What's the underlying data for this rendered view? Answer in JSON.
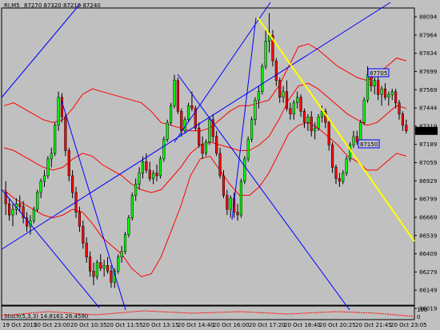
{
  "header": {
    "symbol": "RI,M5",
    "ohlc": "87270 87320 87210 87240"
  },
  "price_axis": {
    "ticks": [
      "88094",
      "87964",
      "87834",
      "87699",
      "87569",
      "87444",
      "87319",
      "87189",
      "87059",
      "86929",
      "86799",
      "86669",
      "86539",
      "86409",
      "86279",
      "86149",
      "86019"
    ],
    "current_price": "87240",
    "marker_high": "87705",
    "marker_low": "87150"
  },
  "time_axis": {
    "ticks": [
      "19 Oct 2015",
      "20 Oct 23:00",
      "20 Oct 10:35",
      "20 Oct 11:55",
      "20 Oct 13:15",
      "20 Oct 14:40",
      "20 Oct 16:00",
      "20 Oct 17:20",
      "20 Oct 18:40",
      "20 Oct 20:25",
      "20 Oct 21:45",
      "20 Oct 23:05"
    ]
  },
  "indicator": {
    "label": "Stoch(5,3,3) 14.8161 26.4590",
    "scale_top": "100",
    "scale_bottom": "0"
  },
  "colors": {
    "background": "#c0c0c0",
    "bull": "#00ff00",
    "bear": "#ff0000",
    "wick": "#000000",
    "bands": "#ff0000",
    "trendlines": "#0000ff",
    "fibo_line": "#ffff00"
  },
  "chart_data": {
    "type": "candlestick",
    "symbol": "RI,M5",
    "ylim": [
      86019,
      88094
    ],
    "candles": [
      [
        86800,
        86880,
        86640,
        86720
      ],
      [
        86720,
        86760,
        86600,
        86640
      ],
      [
        86640,
        86720,
        86560,
        86680
      ],
      [
        86680,
        86760,
        86640,
        86720
      ],
      [
        86720,
        86780,
        86660,
        86700
      ],
      [
        86700,
        86740,
        86580,
        86620
      ],
      [
        86620,
        86660,
        86520,
        86560
      ],
      [
        86560,
        86640,
        86500,
        86600
      ],
      [
        86600,
        86700,
        86580,
        86680
      ],
      [
        86680,
        86820,
        86660,
        86800
      ],
      [
        86800,
        86900,
        86760,
        86880
      ],
      [
        86880,
        86960,
        86840,
        86920
      ],
      [
        86920,
        87060,
        86900,
        87040
      ],
      [
        87040,
        87120,
        86980,
        87080
      ],
      [
        87080,
        87300,
        87060,
        87280
      ],
      [
        87280,
        87520,
        87240,
        87480
      ],
      [
        87480,
        87510,
        87300,
        87340
      ],
      [
        87340,
        87360,
        87060,
        87100
      ],
      [
        87100,
        87120,
        86880,
        86920
      ],
      [
        86920,
        86960,
        86760,
        86800
      ],
      [
        86800,
        86840,
        86620,
        86660
      ],
      [
        86660,
        86700,
        86520,
        86560
      ],
      [
        86560,
        86600,
        86400,
        86440
      ],
      [
        86440,
        86480,
        86300,
        86340
      ],
      [
        86340,
        86380,
        86200,
        86240
      ],
      [
        86240,
        86300,
        86140,
        86200
      ],
      [
        86200,
        86320,
        86180,
        86300
      ],
      [
        86300,
        86360,
        86240,
        86260
      ],
      [
        86260,
        86320,
        86200,
        86280
      ],
      [
        86280,
        86340,
        86220,
        86240
      ],
      [
        86240,
        86280,
        86120,
        86160
      ],
      [
        86160,
        86260,
        86120,
        86240
      ],
      [
        86240,
        86360,
        86220,
        86340
      ],
      [
        86340,
        86420,
        86300,
        86380
      ],
      [
        86380,
        86520,
        86360,
        86500
      ],
      [
        86500,
        86640,
        86480,
        86620
      ],
      [
        86620,
        86800,
        86600,
        86780
      ],
      [
        86780,
        86900,
        86740,
        86860
      ],
      [
        86860,
        86980,
        86820,
        86940
      ],
      [
        86940,
        87060,
        86900,
        87020
      ],
      [
        87020,
        87080,
        86940,
        86960
      ],
      [
        86960,
        87020,
        86880,
        86900
      ],
      [
        86900,
        86960,
        86860,
        86940
      ],
      [
        86940,
        87000,
        86880,
        86920
      ],
      [
        86920,
        87060,
        86900,
        87040
      ],
      [
        87040,
        87200,
        87020,
        87180
      ],
      [
        87180,
        87320,
        87160,
        87300
      ],
      [
        87300,
        87440,
        87280,
        87420
      ],
      [
        87420,
        87640,
        87400,
        87600
      ],
      [
        87600,
        87620,
        87360,
        87380
      ],
      [
        87380,
        87400,
        87200,
        87240
      ],
      [
        87240,
        87340,
        87220,
        87320
      ],
      [
        87320,
        87440,
        87300,
        87420
      ],
      [
        87420,
        87520,
        87380,
        87400
      ],
      [
        87400,
        87420,
        87240,
        87260
      ],
      [
        87260,
        87300,
        87120,
        87140
      ],
      [
        87140,
        87200,
        87040,
        87080
      ],
      [
        87080,
        87180,
        87060,
        87160
      ],
      [
        87160,
        87340,
        87140,
        87320
      ],
      [
        87320,
        87360,
        87160,
        87200
      ],
      [
        87200,
        87240,
        87060,
        87080
      ],
      [
        87080,
        87120,
        86900,
        86920
      ],
      [
        86920,
        86960,
        86760,
        86780
      ],
      [
        86780,
        86820,
        86640,
        86680
      ],
      [
        86680,
        86780,
        86620,
        86760
      ],
      [
        86760,
        86800,
        86620,
        86660
      ],
      [
        86660,
        86720,
        86600,
        86640
      ],
      [
        86640,
        86900,
        86620,
        86880
      ],
      [
        86880,
        87060,
        86860,
        87040
      ],
      [
        87040,
        87200,
        87020,
        87180
      ],
      [
        87180,
        87340,
        87160,
        87320
      ],
      [
        87320,
        87480,
        87280,
        87460
      ],
      [
        87460,
        87560,
        87400,
        87520
      ],
      [
        87520,
        87720,
        87500,
        87700
      ],
      [
        87700,
        87960,
        87680,
        87880
      ],
      [
        87880,
        88080,
        87800,
        87920
      ],
      [
        87920,
        87960,
        87700,
        87740
      ],
      [
        87740,
        87760,
        87560,
        87600
      ],
      [
        87600,
        87620,
        87440,
        87480
      ],
      [
        87480,
        87560,
        87440,
        87520
      ],
      [
        87520,
        87600,
        87380,
        87400
      ],
      [
        87400,
        87440,
        87320,
        87360
      ],
      [
        87360,
        87460,
        87320,
        87440
      ],
      [
        87440,
        87520,
        87400,
        87480
      ],
      [
        87480,
        87500,
        87340,
        87380
      ],
      [
        87380,
        87400,
        87260,
        87300
      ],
      [
        87300,
        87360,
        87240,
        87340
      ],
      [
        87340,
        87380,
        87200,
        87240
      ],
      [
        87240,
        87300,
        87180,
        87260
      ],
      [
        87260,
        87360,
        87240,
        87340
      ],
      [
        87340,
        87420,
        87300,
        87380
      ],
      [
        87380,
        87400,
        87260,
        87300
      ],
      [
        87300,
        87320,
        87100,
        87140
      ],
      [
        87140,
        87160,
        86940,
        86980
      ],
      [
        86980,
        87000,
        86860,
        86900
      ],
      [
        86900,
        86940,
        86840,
        86880
      ],
      [
        86880,
        86960,
        86860,
        86940
      ],
      [
        86940,
        87060,
        86920,
        87040
      ],
      [
        87040,
        87160,
        87020,
        87140
      ],
      [
        87140,
        87240,
        87120,
        87200
      ],
      [
        87200,
        87240,
        87140,
        87160
      ],
      [
        87160,
        87320,
        87140,
        87300
      ],
      [
        87300,
        87480,
        87280,
        87460
      ],
      [
        87460,
        87700,
        87440,
        87640
      ],
      [
        87640,
        87680,
        87520,
        87560
      ],
      [
        87560,
        87620,
        87500,
        87600
      ],
      [
        87600,
        87640,
        87460,
        87500
      ],
      [
        87500,
        87560,
        87420,
        87540
      ],
      [
        87540,
        87580,
        87460,
        87480
      ],
      [
        87480,
        87520,
        87420,
        87500
      ],
      [
        87500,
        87540,
        87460,
        87520
      ],
      [
        87520,
        87540,
        87400,
        87440
      ],
      [
        87440,
        87460,
        87320,
        87360
      ],
      [
        87360,
        87380,
        87240,
        87280
      ],
      [
        87280,
        87320,
        87220,
        87240
      ]
    ],
    "bands": {
      "upper": [
        87420,
        87440,
        87400,
        87360,
        87320,
        87300,
        87320,
        87400,
        87500,
        87540,
        87520,
        87500,
        87480,
        87460,
        87440,
        87380,
        87300,
        87280,
        87260,
        87240,
        87240,
        87260,
        87320,
        87380,
        87420,
        87420,
        87440,
        87460,
        87560,
        87700,
        87840,
        87860,
        87820,
        87760,
        87700,
        87660,
        87620,
        87600,
        87640,
        87700,
        87760,
        87740
      ],
      "middle": [
        87120,
        87100,
        87060,
        87020,
        86980,
        86960,
        86980,
        87040,
        87080,
        87060,
        87000,
        86960,
        86920,
        86860,
        86820,
        86800,
        86820,
        86900,
        86980,
        87080,
        87140,
        87160,
        87140,
        87120,
        87100,
        87100,
        87140,
        87200,
        87320,
        87460,
        87560,
        87580,
        87540,
        87480,
        87420,
        87360,
        87320,
        87280,
        87300,
        87360,
        87420,
        87400
      ],
      "lower": [
        86820,
        86760,
        86720,
        86680,
        86640,
        86620,
        86640,
        86680,
        86660,
        86580,
        86480,
        86420,
        86360,
        86260,
        86200,
        86220,
        86340,
        86520,
        86700,
        86920,
        87040,
        87060,
        86960,
        86860,
        86780,
        86780,
        86840,
        86940,
        87080,
        87220,
        87280,
        87300,
        87260,
        87200,
        87140,
        87060,
        87020,
        86960,
        86960,
        87020,
        87080,
        87060
      ]
    },
    "stochastic": {
      "k": 14.8161,
      "d": 26.459
    }
  }
}
